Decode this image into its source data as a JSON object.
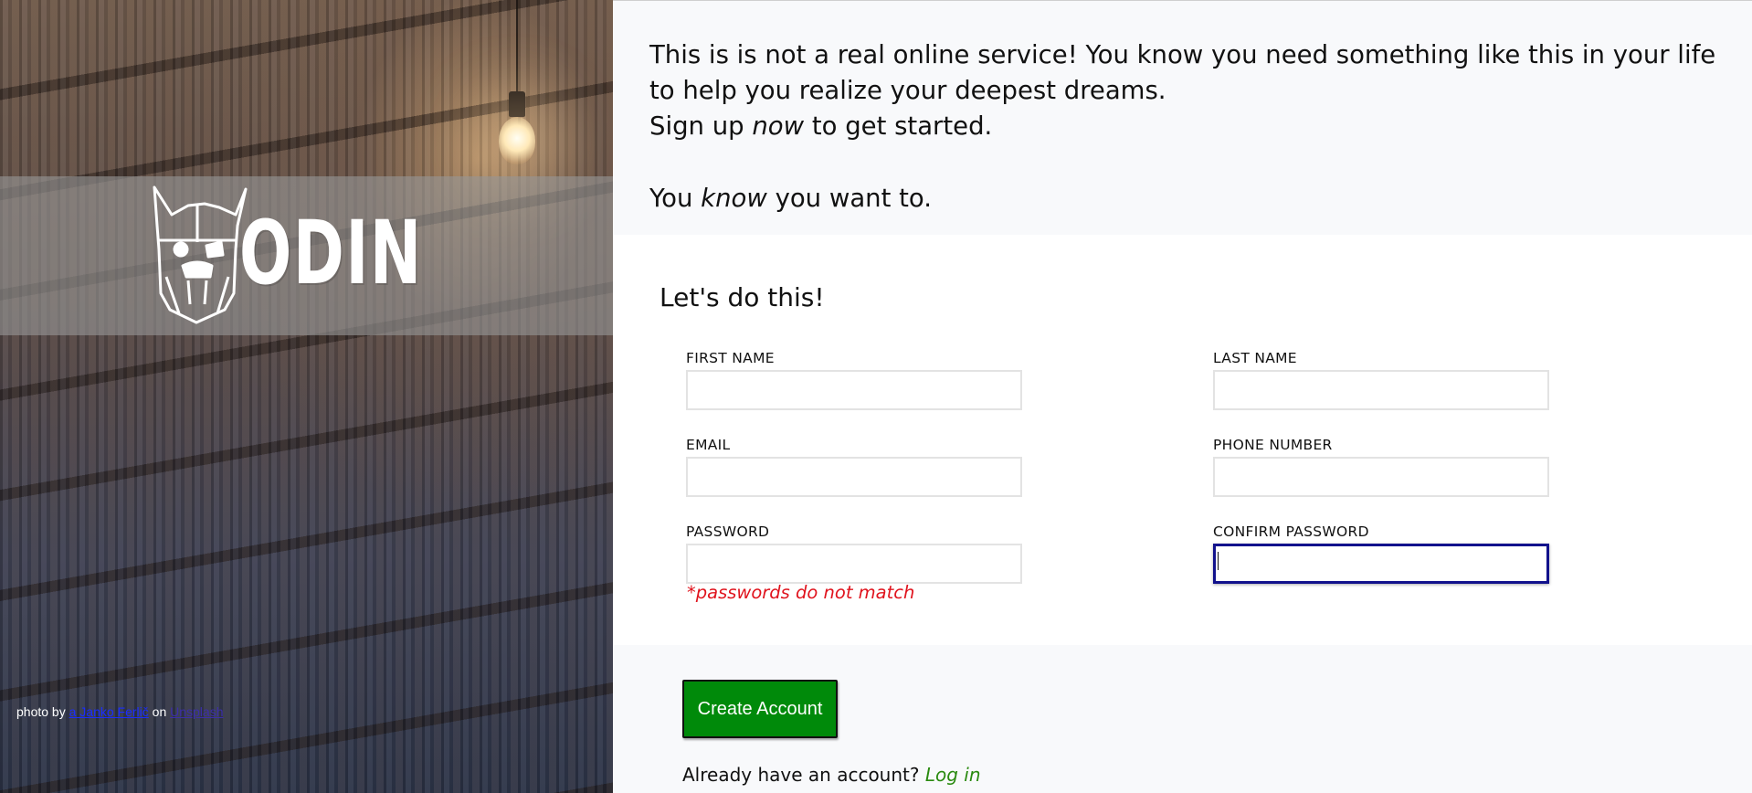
{
  "hero": {
    "logo_text": "ODIN",
    "photo_credit": {
      "prefix": "photo by",
      "author_link": "a Janko Ferlič",
      "middle": "on",
      "source_link": "Unsplash"
    }
  },
  "intro": {
    "line1": "This is is not a real online service! You know you need something like this in your life to help you realize your deepest dreams.",
    "line2_before": "Sign up ",
    "line2_em": "now",
    "line2_after": " to get started.",
    "line3_before": "You ",
    "line3_em": "know",
    "line3_after": " you want to."
  },
  "form": {
    "title": "Let's do this!",
    "fields": {
      "first_name": {
        "label": "FIRST NAME",
        "value": ""
      },
      "last_name": {
        "label": "LAST NAME",
        "value": ""
      },
      "email": {
        "label": "EMAIL",
        "value": ""
      },
      "phone": {
        "label": "PHONE NUMBER",
        "value": ""
      },
      "password": {
        "label": "PASSWORD",
        "value": ""
      },
      "confirm_password": {
        "label": "CONFIRM PASSWORD",
        "value": ""
      }
    },
    "error": "*passwords do not match"
  },
  "actions": {
    "create_label": "Create Account",
    "login_prompt": "Already have an account?",
    "login_link": "Log in"
  },
  "colors": {
    "accent_green": "#008a0a",
    "error_red": "#e0141e",
    "focus_blue": "#12128c"
  },
  "icons": {
    "logo": "viking-helmet-logo-icon"
  }
}
